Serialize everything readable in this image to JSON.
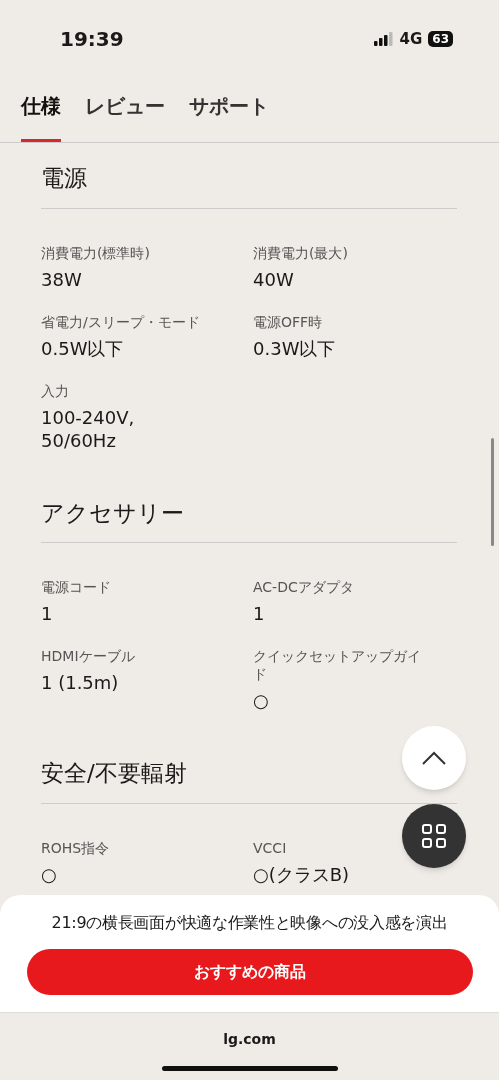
{
  "status_bar": {
    "time": "19:39",
    "network": "4G",
    "battery": "63"
  },
  "tabs": [
    {
      "label": "仕様",
      "selected": true
    },
    {
      "label": "レビュー",
      "selected": false
    },
    {
      "label": "サポート",
      "selected": false
    }
  ],
  "sections": [
    {
      "title": "電源",
      "specs": [
        {
          "label": "消費電力(標準時)",
          "value": "38W"
        },
        {
          "label": "消費電力(最大)",
          "value": "40W"
        },
        {
          "label": "省電力/スリープ・モード",
          "value": "0.5W以下"
        },
        {
          "label": "電源OFF時",
          "value": "0.3W以下"
        },
        {
          "label": "入力",
          "value": "100-240V,\n50/60Hz"
        }
      ]
    },
    {
      "title": "アクセサリー",
      "specs": [
        {
          "label": "電源コード",
          "value": "1"
        },
        {
          "label": "AC-DCアダプタ",
          "value": "1"
        },
        {
          "label": "HDMIケーブル",
          "value": "1 (1.5m)"
        },
        {
          "label": "クイックセットアップガイド",
          "value": "○"
        }
      ]
    },
    {
      "title": "安全/不要輻射",
      "specs": [
        {
          "label": "ROHS指令",
          "value": "○"
        },
        {
          "label": "VCCI",
          "value": "○(クラスB)"
        }
      ]
    }
  ],
  "sheet": {
    "text": "21:9の横長画面が快適な作業性と映像への没入感を演出",
    "button": "おすすめの商品"
  },
  "address_bar": {
    "url": "lg.com"
  }
}
